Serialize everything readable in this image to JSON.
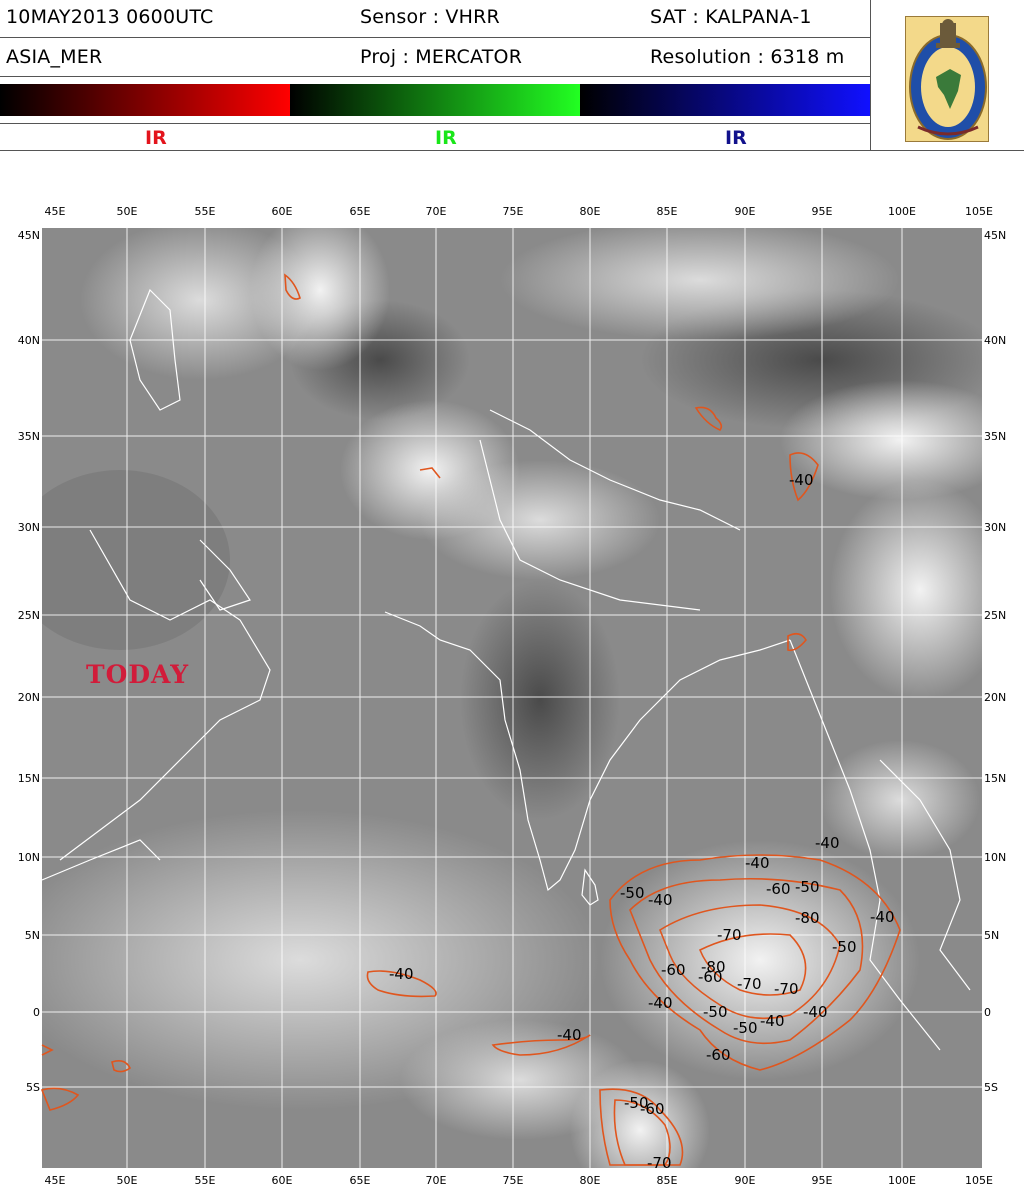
{
  "header": {
    "date_time": "10MAY2013  0600UTC",
    "sensor": "Sensor : VHRR",
    "satellite": "SAT : KALPANA-1",
    "region": "ASIA_MER",
    "projection": "Proj : MERCATOR",
    "resolution": "Resolution : 6318 m"
  },
  "colorbar": {
    "channels": [
      {
        "label": "IR",
        "color": "#e3141c"
      },
      {
        "label": "IR",
        "color": "#19e619"
      },
      {
        "label": "IR",
        "color": "#11118c"
      }
    ]
  },
  "map": {
    "top_lon_labels": [
      "45E",
      "50E",
      "55E",
      "60E",
      "65E",
      "70E",
      "75E",
      "80E",
      "85E",
      "90E",
      "95E",
      "100E",
      "105E"
    ],
    "bottom_lon_labels": [
      "45E",
      "50E",
      "55E",
      "60E",
      "65E",
      "70E",
      "75E",
      "80E",
      "85E",
      "90E",
      "95E",
      "100E",
      "105E"
    ],
    "left_lat_labels": [
      "45N",
      "40N",
      "35N",
      "30N",
      "25N",
      "20N",
      "15N",
      "10N",
      "5N",
      "0",
      "5S"
    ],
    "right_lat_labels": [
      "45N",
      "40N",
      "35N",
      "30N",
      "25N",
      "20N",
      "15N",
      "10N",
      "5N",
      "0",
      "5S"
    ],
    "annotation": "TODAY",
    "contour_color": "#e0561e",
    "contour_labels": [
      "-40",
      "-40",
      "-40",
      "-40",
      "-40",
      "-40",
      "-40",
      "-40",
      "-50",
      "-50",
      "-50",
      "-50",
      "-50",
      "-50",
      "-60",
      "-60",
      "-60",
      "-60",
      "-60",
      "-70",
      "-70",
      "-70",
      "-70",
      "-80",
      "-80",
      "-40",
      "-40"
    ]
  }
}
